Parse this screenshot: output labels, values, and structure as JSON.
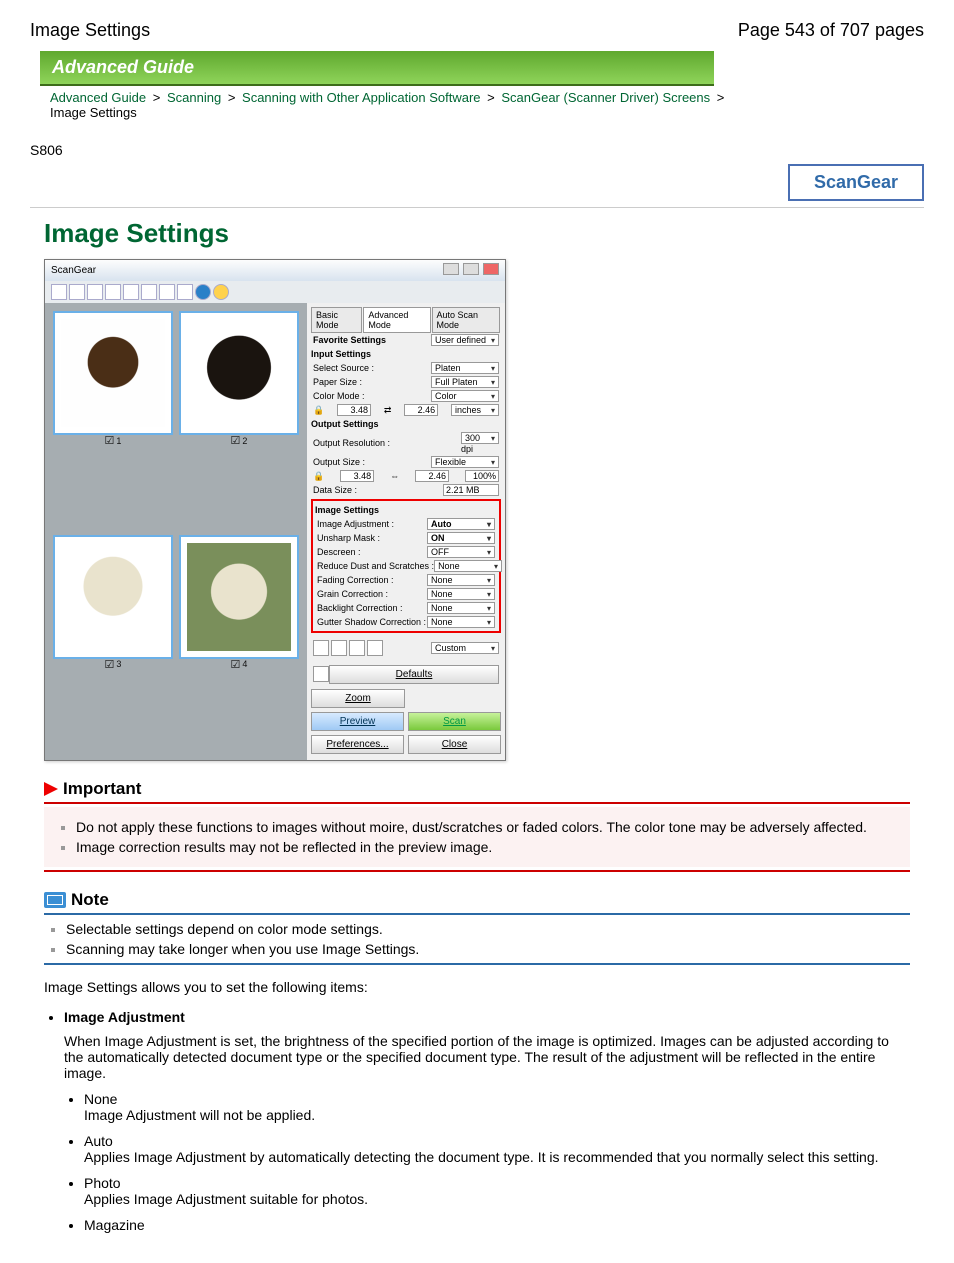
{
  "header": {
    "title_left": "Image Settings",
    "title_right": "Page 543 of 707 pages"
  },
  "banner": "Advanced Guide",
  "breadcrumbs": {
    "items": [
      "Advanced Guide",
      "Scanning",
      "Scanning with Other Application Software",
      "ScanGear (Scanner Driver) Screens"
    ],
    "current": "Image Settings",
    "sep": ">"
  },
  "doc_id": "S806",
  "brand_box": "ScanGear",
  "page_title": "Image Settings",
  "app": {
    "window_title": "ScanGear",
    "tabs": {
      "basic": "Basic Mode",
      "advanced": "Advanced Mode",
      "auto": "Auto Scan Mode"
    },
    "favorite": {
      "label": "Favorite Settings",
      "value": "User defined"
    },
    "input_settings": {
      "header": "Input Settings",
      "select_source": {
        "label": "Select Source :",
        "value": "Platen"
      },
      "paper_size": {
        "label": "Paper Size :",
        "value": "Full Platen"
      },
      "color_mode": {
        "label": "Color Mode :",
        "value": "Color"
      },
      "dim1": "3.48",
      "dim2": "2.46",
      "units": "inches"
    },
    "output_settings": {
      "header": "Output Settings",
      "resolution": {
        "label": "Output Resolution :",
        "value": "300",
        "unit": "dpi"
      },
      "output_size": {
        "label": "Output Size :",
        "value": "Flexible"
      },
      "w": "3.48",
      "h": "2.46",
      "pct": "100%",
      "data_size": {
        "label": "Data Size :",
        "value": "2.21 MB"
      }
    },
    "image_settings": {
      "header": "Image Settings",
      "rows": [
        {
          "label": "Image Adjustment :",
          "value": "Auto"
        },
        {
          "label": "Unsharp Mask :",
          "value": "ON"
        },
        {
          "label": "Descreen :",
          "value": "OFF"
        },
        {
          "label": "Reduce Dust and Scratches :",
          "value": "None"
        },
        {
          "label": "Fading Correction :",
          "value": "None"
        },
        {
          "label": "Grain Correction :",
          "value": "None"
        },
        {
          "label": "Backlight Correction :",
          "value": "None"
        },
        {
          "label": "Gutter Shadow Correction :",
          "value": "None"
        }
      ]
    },
    "custom": "Custom",
    "defaults": "Defaults",
    "zoom": "Zoom",
    "preview": "Preview",
    "scan": "Scan",
    "preferences": "Preferences...",
    "close": "Close",
    "thumbs": [
      "1",
      "2",
      "3",
      "4"
    ]
  },
  "important": {
    "title": "Important",
    "items": [
      "Do not apply these functions to images without moire, dust/scratches or faded colors. The color tone may be adversely affected.",
      "Image correction results may not be reflected in the preview image."
    ]
  },
  "note": {
    "title": "Note",
    "items": [
      "Selectable settings depend on color mode settings.",
      "Scanning may take longer when you use Image Settings."
    ]
  },
  "intro": "Image Settings allows you to set the following items:",
  "items": {
    "image_adjustment": {
      "term": "Image Adjustment",
      "desc": "When Image Adjustment is set, the brightness of the specified portion of the image is optimized. Images can be adjusted according to the automatically detected document type or the specified document type. The result of the adjustment will be reflected in the entire image.",
      "subs": [
        {
          "term": "None",
          "desc": "Image Adjustment will not be applied."
        },
        {
          "term": "Auto",
          "desc": "Applies Image Adjustment by automatically detecting the document type. It is recommended that you normally select this setting."
        },
        {
          "term": "Photo",
          "desc": "Applies Image Adjustment suitable for photos."
        },
        {
          "term": "Magazine",
          "desc": ""
        }
      ]
    }
  }
}
